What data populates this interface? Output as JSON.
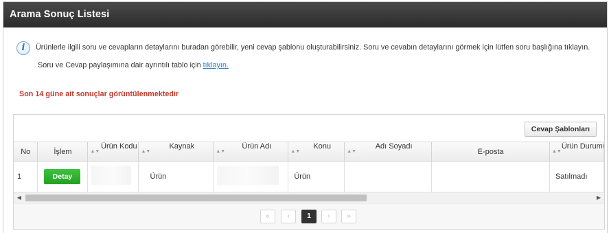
{
  "panel": {
    "title": "Arama Sonuç Listesi"
  },
  "info": {
    "icon": "info-icon",
    "line1": "Ürünlerle ilgili soru ve cevapların detaylarını buradan görebilir, yeni cevap şablonu oluşturabilirsiniz. Soru ve cevabın detaylarını görmek için lütfen soru başlığına tıklayın.",
    "line2_prefix": "Soru ve Cevap paylaşımına dair ayrıntılı tablo için",
    "line2_link": "tıklayın."
  },
  "warning": "Son 14 güne ait sonuçlar görüntülenmektedir",
  "toolbar": {
    "templates_button": "Cevap Şablonları"
  },
  "table": {
    "headers": [
      "No",
      "İşlem",
      "Ürün Kodu",
      "Kaynak",
      "Ürün Adı",
      "Konu",
      "Adı Soyadı",
      "E-posta",
      "Ürün Durumu"
    ],
    "rows": [
      {
        "no": "1",
        "action": "Detay",
        "product_code": "",
        "source": "Ürün",
        "product_name": "",
        "subject": "Ürün",
        "full_name": "",
        "email": "",
        "status": "Satılmadı"
      }
    ]
  },
  "pager": {
    "first": "«",
    "prev": "‹",
    "current": "1",
    "next": "›",
    "last": "»"
  }
}
